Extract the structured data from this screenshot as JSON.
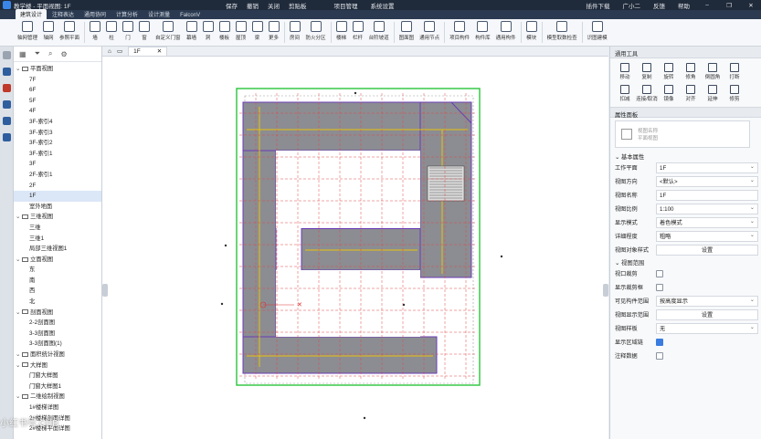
{
  "window": {
    "title": "教学楼 - 平面视图: 1F",
    "quick_actions": [
      "保存",
      "撤销",
      "关闭",
      "剪贴板"
    ],
    "menus": [
      "项目管理",
      "系统设置"
    ],
    "right_items": [
      "插件下载",
      "广小二",
      "反馈",
      "帮助"
    ]
  },
  "tabs": [
    {
      "label": "建筑设计",
      "active": true
    },
    {
      "label": "注释表达",
      "active": false
    },
    {
      "label": "通用协同",
      "active": false
    },
    {
      "label": "计算分析",
      "active": false
    },
    {
      "label": "设计测量",
      "active": false
    },
    {
      "label": "FalconV",
      "active": false
    }
  ],
  "ribbon": [
    [
      "轴网管理",
      "轴网",
      "参照平面"
    ],
    [
      "墙",
      "柱",
      "门",
      "窗",
      "自定义门窗",
      "幕墙",
      "洞",
      "楼板",
      "屋顶",
      "梁",
      "更多"
    ],
    [
      "房间",
      "防火分区"
    ],
    [
      "楼梯",
      "栏杆",
      "台阶坡道"
    ],
    [
      "图面图",
      "通用节点"
    ],
    [
      "项目构件",
      "构件库",
      "通用构件"
    ],
    [
      "模块"
    ],
    [
      "模型取数检查"
    ],
    [
      "识图建模"
    ]
  ],
  "tree": [
    {
      "label": "平面视图",
      "level": 0,
      "folder": true
    },
    {
      "label": "7F",
      "level": 1
    },
    {
      "label": "6F",
      "level": 1
    },
    {
      "label": "5F",
      "level": 1
    },
    {
      "label": "4F",
      "level": 1
    },
    {
      "label": "3F-索引4",
      "level": 1
    },
    {
      "label": "3F-索引3",
      "level": 1
    },
    {
      "label": "3F-索引2",
      "level": 1
    },
    {
      "label": "3F-索引1",
      "level": 1
    },
    {
      "label": "3F",
      "level": 1
    },
    {
      "label": "2F-索引1",
      "level": 1
    },
    {
      "label": "2F",
      "level": 1
    },
    {
      "label": "1F",
      "level": 1,
      "selected": true
    },
    {
      "label": "室外地面",
      "level": 1
    },
    {
      "label": "三维视图",
      "level": 0,
      "folder": true
    },
    {
      "label": "三维",
      "level": 1
    },
    {
      "label": "三维1",
      "level": 1
    },
    {
      "label": "局部三维视图1",
      "level": 1
    },
    {
      "label": "立面视图",
      "level": 0,
      "folder": true
    },
    {
      "label": "东",
      "level": 1
    },
    {
      "label": "南",
      "level": 1
    },
    {
      "label": "西",
      "level": 1
    },
    {
      "label": "北",
      "level": 1
    },
    {
      "label": "剖面视图",
      "level": 0,
      "folder": true
    },
    {
      "label": "2-2剖面图",
      "level": 1
    },
    {
      "label": "3-3剖面图",
      "level": 1
    },
    {
      "label": "3-3剖面图(1)",
      "level": 1
    },
    {
      "label": "面积统计视图",
      "level": 0,
      "folder": true
    },
    {
      "label": "大样图",
      "level": 0,
      "folder": true
    },
    {
      "label": "门窗大样图",
      "level": 1
    },
    {
      "label": "门窗大样图1",
      "level": 1
    },
    {
      "label": "二维绘制视图",
      "level": 0,
      "folder": true
    },
    {
      "label": "1#楼梯详图",
      "level": 1
    },
    {
      "label": "2#楼梯剖面详图",
      "level": 1
    },
    {
      "label": "2#楼梯平面详图",
      "level": 1
    }
  ],
  "doc_tab": {
    "label": "1F"
  },
  "right_panel": {
    "tools_title": "通用工具",
    "tools": [
      "移动",
      "复制",
      "旋转",
      "修角",
      "倒圆角",
      "打断",
      "扣减",
      "连接/取消",
      "镜像",
      "对齐",
      "延伸",
      "修剪"
    ],
    "props_title": "属性面板",
    "view_card_lines": [
      "视图名称",
      "平面视图"
    ],
    "basic_section": "基本属性",
    "props": [
      {
        "label": "工作平面",
        "value": "1F",
        "kind": "select"
      },
      {
        "label": "视图方向",
        "value": "<默认>",
        "kind": "select"
      },
      {
        "label": "视图名称",
        "value": "1F",
        "kind": "text"
      },
      {
        "label": "视图比例",
        "value": "1:100",
        "kind": "select"
      },
      {
        "label": "显示模式",
        "value": "着色模式",
        "kind": "select"
      },
      {
        "label": "详细程度",
        "value": "粗略",
        "kind": "select"
      },
      {
        "label": "视图对象样式",
        "value": "设置",
        "kind": "button"
      }
    ],
    "range_section": "视图范围",
    "range_props": [
      {
        "label": "视口裁剪",
        "checked": false
      },
      {
        "label": "显示裁剪框",
        "checked": false
      }
    ],
    "range_values": [
      {
        "label": "可见构件范围",
        "value": "按高度显示",
        "kind": "select"
      },
      {
        "label": "视图显示范围",
        "value": "设置",
        "kind": "button"
      },
      {
        "label": "视图样板",
        "value": "无",
        "kind": "select"
      }
    ],
    "range_checks": [
      {
        "label": "显示区域链",
        "checked": true
      },
      {
        "label": "注释数据",
        "checked": false
      }
    ]
  },
  "watermark": "小红书号 CHB"
}
